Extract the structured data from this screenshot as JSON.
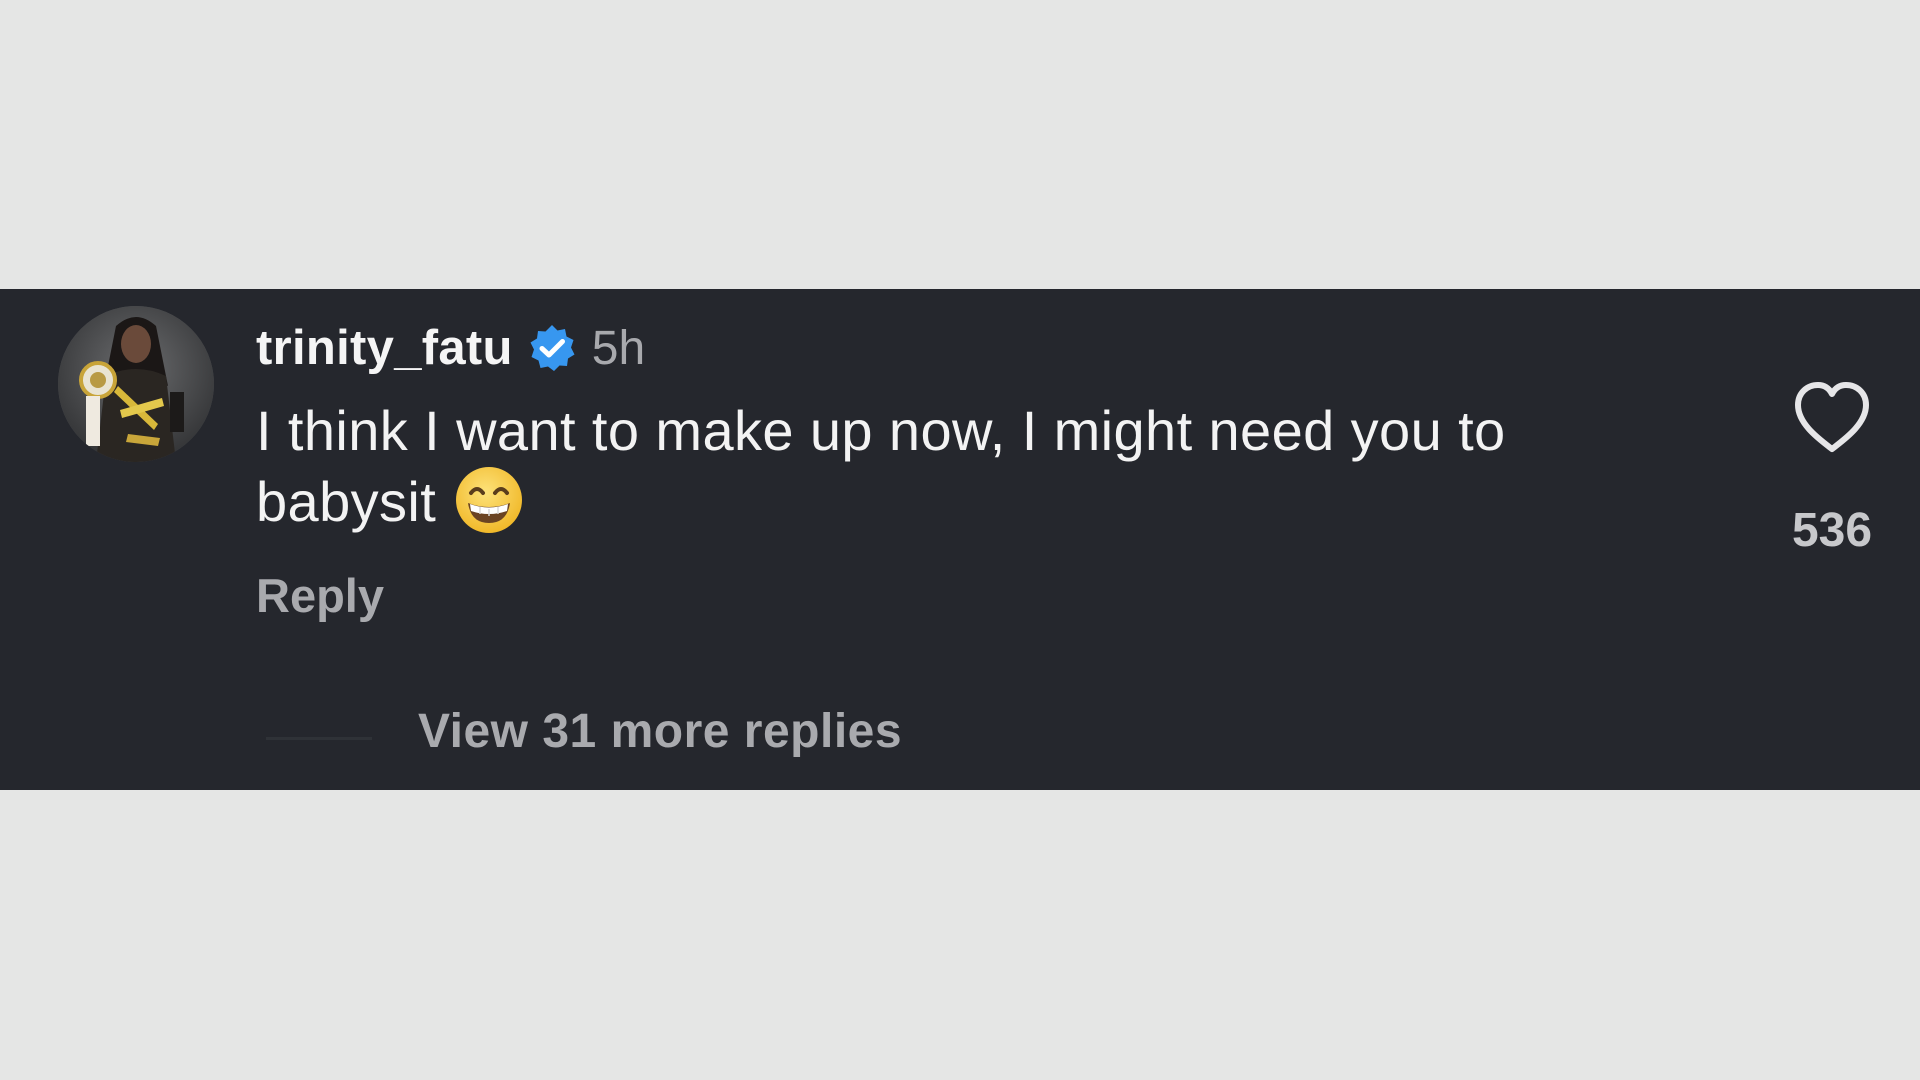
{
  "comment": {
    "username": "trinity_fatu",
    "verified": true,
    "timestamp": "5h",
    "text": "I think I want to make up now, I might need you to babysit",
    "emoji": "grinning-face-with-smiling-eyes",
    "reply_label": "Reply",
    "like_icon": "heart-outline-icon",
    "like_count": "536",
    "view_replies_label": "View 31 more replies"
  },
  "colors": {
    "page_background": "#e5e6e5",
    "panel_background": "#25272d",
    "primary_text": "#f3f3f3",
    "secondary_text": "#a9aaae",
    "verified_badge": "#3797f0",
    "emoji_yellow": "#f8c93c"
  }
}
